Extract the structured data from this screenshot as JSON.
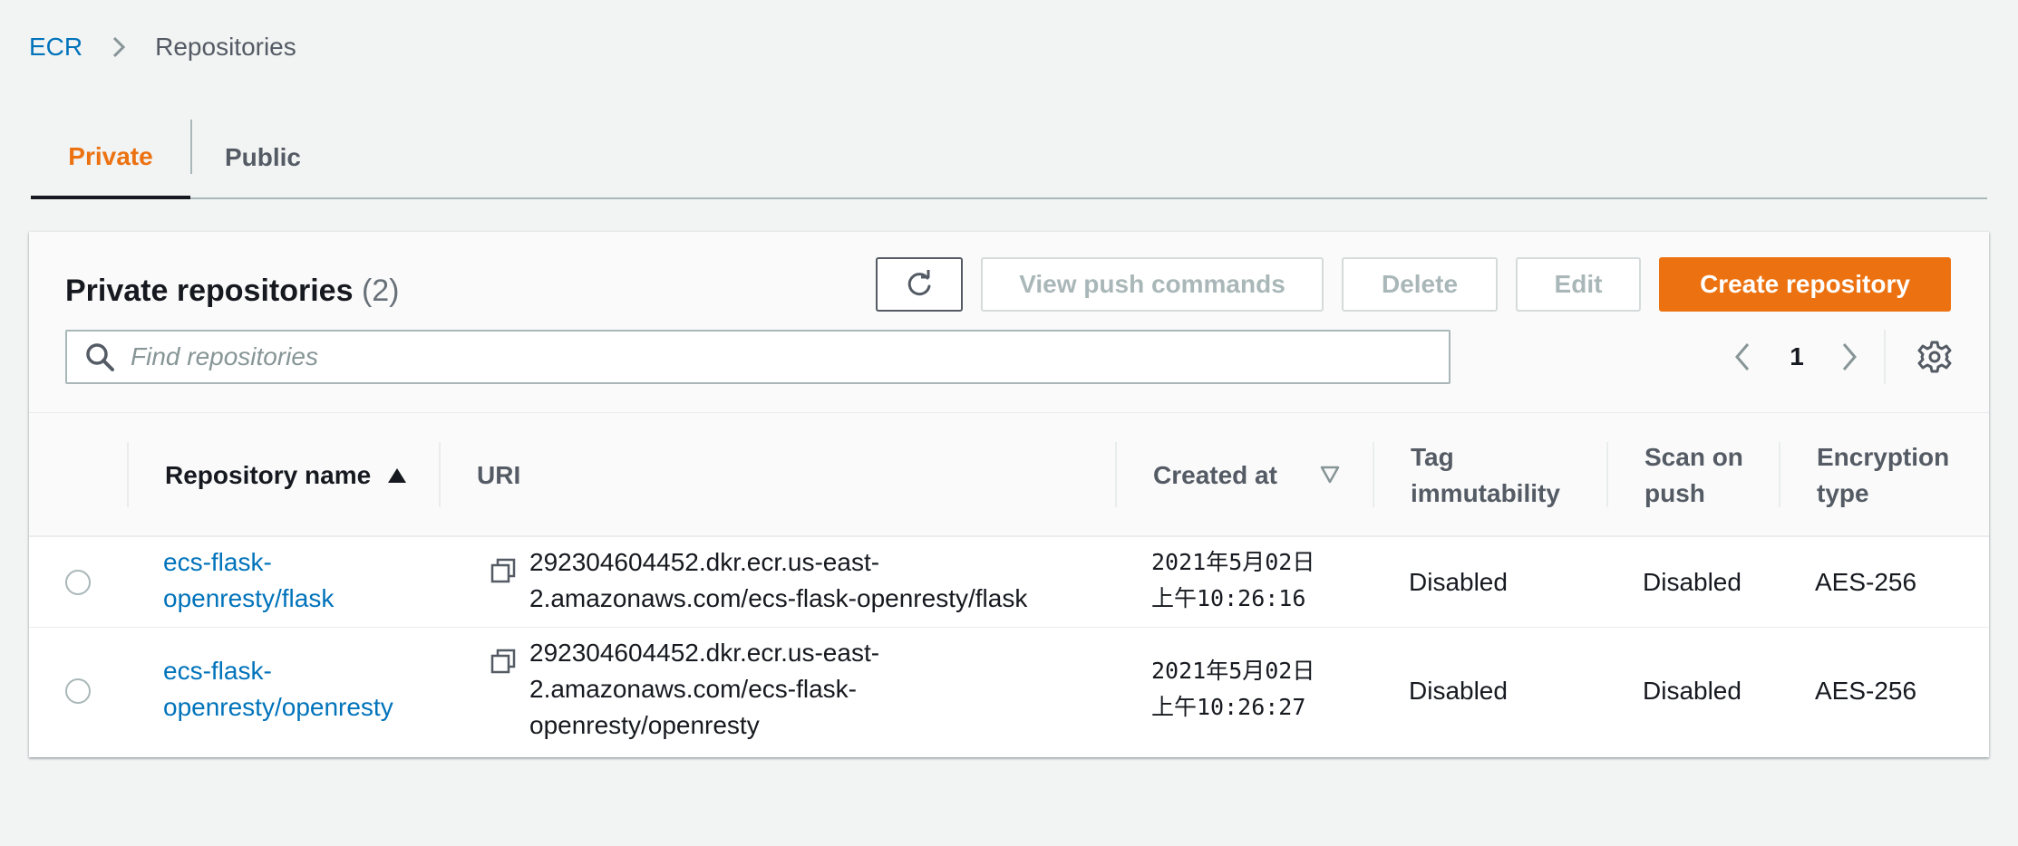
{
  "breadcrumb": {
    "root": "ECR",
    "current": "Repositories"
  },
  "tabs": [
    {
      "label": "Private",
      "active": true
    },
    {
      "label": "Public",
      "active": false
    }
  ],
  "panel": {
    "title": "Private repositories",
    "count": "(2)",
    "buttons": {
      "refresh": "refresh-icon",
      "view_push_commands": "View push commands",
      "delete": "Delete",
      "edit": "Edit",
      "create": "Create repository"
    },
    "search": {
      "placeholder": "Find repositories",
      "value": ""
    },
    "pagination": {
      "page": "1"
    }
  },
  "table": {
    "columns": {
      "name": "Repository name",
      "uri": "URI",
      "created": "Created at",
      "tag_line1": "Tag",
      "tag_line2": "immutability",
      "scan_line1": "Scan on",
      "scan_line2": "push",
      "enc_line1": "Encryption",
      "enc_line2": "type"
    },
    "rows": [
      {
        "name_line1": "ecs-flask-",
        "name_line2": "openresty/flask",
        "uri_line1": "292304604452.dkr.ecr.us-east-",
        "uri_line2": "2.amazonaws.com/ecs-flask-openresty/flask",
        "created_line1": "2021年5月02日",
        "created_line2": "上午10:26:16",
        "tag_immutability": "Disabled",
        "scan_on_push": "Disabled",
        "encryption": "AES-256"
      },
      {
        "name_line1": "ecs-flask-",
        "name_line2": "openresty/openresty",
        "uri_line1": "292304604452.dkr.ecr.us-east-",
        "uri_line2": "2.amazonaws.com/ecs-flask-",
        "uri_line3": "openresty/openresty",
        "created_line1": "2021年5月02日",
        "created_line2": "上午10:26:27",
        "tag_immutability": "Disabled",
        "scan_on_push": "Disabled",
        "encryption": "AES-256"
      }
    ]
  },
  "colors": {
    "accent": "#ec7211",
    "link": "#0073bb",
    "text": "#16191f",
    "muted": "#545b64",
    "background": "#f2f3f3"
  }
}
